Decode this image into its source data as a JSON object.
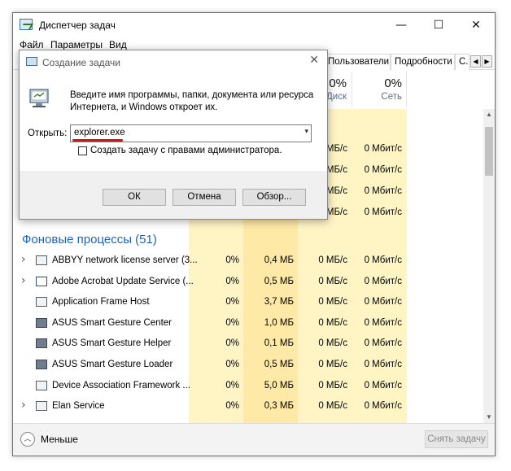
{
  "window": {
    "title": "Диспетчер задач",
    "controls": [
      "—",
      "☐",
      "✕"
    ]
  },
  "menu": [
    "Файл",
    "Параметры",
    "Вид"
  ],
  "tabs": [
    "Пользователи",
    "Подробности",
    "С."
  ],
  "columns": [
    {
      "pct": "0%",
      "name": "Диск"
    },
    {
      "pct": "0%",
      "name": "Сеть"
    }
  ],
  "partial_rows": [
    {
      "disk": "МБ/с",
      "net": "0 Мбит/с"
    },
    {
      "disk": "МБ/с",
      "net": "0 Мбит/с"
    },
    {
      "disk": "МБ/с",
      "net": "0 Мбит/с"
    },
    {
      "disk": "МБ/с",
      "net": "0 Мбит/с"
    }
  ],
  "section_title": "Фоновые процессы (51)",
  "processes": [
    {
      "name": "ABBYY network license server (3...",
      "cpu": "0%",
      "mem": "0,4 МБ",
      "disk": "0 МБ/с",
      "net": "0 Мбит/с",
      "expandable": true,
      "icon": "app-window-icon"
    },
    {
      "name": "Adobe Acrobat Update Service (...",
      "cpu": "0%",
      "mem": "0,5 МБ",
      "disk": "0 МБ/с",
      "net": "0 Мбит/с",
      "expandable": true,
      "icon": "blank-window-icon"
    },
    {
      "name": "Application Frame Host",
      "cpu": "0%",
      "mem": "3,7 МБ",
      "disk": "0 МБ/с",
      "net": "0 Мбит/с",
      "expandable": false,
      "icon": "app-window-icon"
    },
    {
      "name": "ASUS Smart Gesture Center",
      "cpu": "0%",
      "mem": "1,0 МБ",
      "disk": "0 МБ/с",
      "net": "0 Мбит/с",
      "expandable": false,
      "icon": "asus-icon"
    },
    {
      "name": "ASUS Smart Gesture Helper",
      "cpu": "0%",
      "mem": "0,1 МБ",
      "disk": "0 МБ/с",
      "net": "0 Мбит/с",
      "expandable": false,
      "icon": "asus-icon"
    },
    {
      "name": "ASUS Smart Gesture Loader",
      "cpu": "0%",
      "mem": "0,5 МБ",
      "disk": "0 МБ/с",
      "net": "0 Мбит/с",
      "expandable": false,
      "icon": "asus-loader-icon"
    },
    {
      "name": "Device Association Framework ...",
      "cpu": "0%",
      "mem": "5,0 МБ",
      "disk": "0 МБ/с",
      "net": "0 Мбит/с",
      "expandable": false,
      "icon": "app-window-icon"
    },
    {
      "name": "Elan Service",
      "cpu": "0%",
      "mem": "0,3 МБ",
      "disk": "0 МБ/с",
      "net": "0 Мбит/с",
      "expandable": true,
      "icon": "app-window-icon"
    }
  ],
  "footer": {
    "less_label": "Меньше",
    "end_task_label": "Снять задачу"
  },
  "dialog": {
    "title": "Создание задачи",
    "description": "Введите имя программы, папки, документа или ресурса Интернета, и Windows откроет их.",
    "open_label": "Открыть:",
    "open_value": "explorer.exe",
    "admin_label": "Создать задачу с правами администратора.",
    "ok_label": "ОК",
    "cancel_label": "Отмена",
    "browse_label": "Обзор..."
  },
  "colors": {
    "heat_light": "#fff4c4",
    "heat_mid": "#ffe9a6",
    "section_blue": "#1f63b5",
    "underline_red": "#e01010"
  }
}
